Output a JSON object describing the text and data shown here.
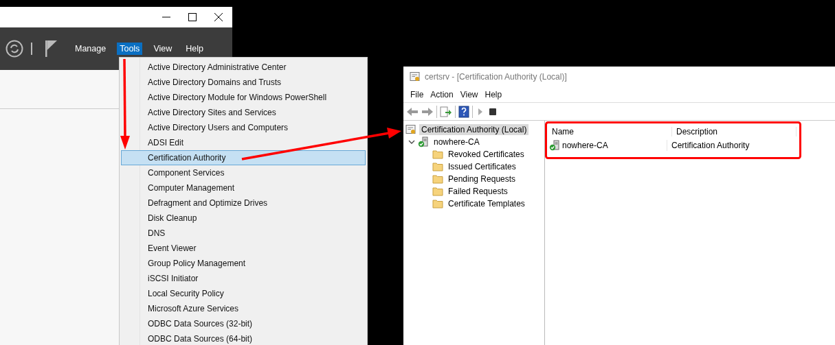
{
  "server_manager": {
    "menu_bar": [
      {
        "label": "Manage",
        "selected": false
      },
      {
        "label": "Tools",
        "selected": true
      },
      {
        "label": "View",
        "selected": false
      },
      {
        "label": "Help",
        "selected": false
      }
    ]
  },
  "tools_menu": {
    "items": [
      {
        "label": "Active Directory Administrative Center",
        "selected": false
      },
      {
        "label": "Active Directory Domains and Trusts",
        "selected": false
      },
      {
        "label": "Active Directory Module for Windows PowerShell",
        "selected": false
      },
      {
        "label": "Active Directory Sites and Services",
        "selected": false
      },
      {
        "label": "Active Directory Users and Computers",
        "selected": false
      },
      {
        "label": "ADSI Edit",
        "selected": false
      },
      {
        "label": "Certification Authority",
        "selected": true
      },
      {
        "label": "Component Services",
        "selected": false
      },
      {
        "label": "Computer Management",
        "selected": false
      },
      {
        "label": "Defragment and Optimize Drives",
        "selected": false
      },
      {
        "label": "Disk Cleanup",
        "selected": false
      },
      {
        "label": "DNS",
        "selected": false
      },
      {
        "label": "Event Viewer",
        "selected": false
      },
      {
        "label": "Group Policy Management",
        "selected": false
      },
      {
        "label": "iSCSI Initiator",
        "selected": false
      },
      {
        "label": "Local Security Policy",
        "selected": false
      },
      {
        "label": "Microsoft Azure Services",
        "selected": false
      },
      {
        "label": "ODBC Data Sources (32-bit)",
        "selected": false
      },
      {
        "label": "ODBC Data Sources (64-bit)",
        "selected": false
      }
    ]
  },
  "certsrv": {
    "window": {
      "title": "certsrv - [Certification Authority (Local)]"
    },
    "menu_bar": [
      "File",
      "Action",
      "View",
      "Help"
    ],
    "tree": [
      {
        "label": "Certification Authority (Local)",
        "kind": "root",
        "selected": true,
        "children": [
          {
            "label": "nowhere-CA",
            "kind": "ca",
            "selected": false,
            "expanded": true,
            "children": [
              {
                "label": "Revoked Certificates",
                "kind": "folder",
                "selected": false
              },
              {
                "label": "Issued Certificates",
                "kind": "folder",
                "selected": false
              },
              {
                "label": "Pending Requests",
                "kind": "folder",
                "selected": false
              },
              {
                "label": "Failed Requests",
                "kind": "folder",
                "selected": false
              },
              {
                "label": "Certificate Templates",
                "kind": "folder",
                "selected": false
              }
            ]
          }
        ]
      }
    ],
    "list": {
      "columns": [
        "Name",
        "Description"
      ],
      "rows": [
        {
          "name": "nowhere-CA",
          "description": "Certification Authority"
        }
      ]
    }
  }
}
